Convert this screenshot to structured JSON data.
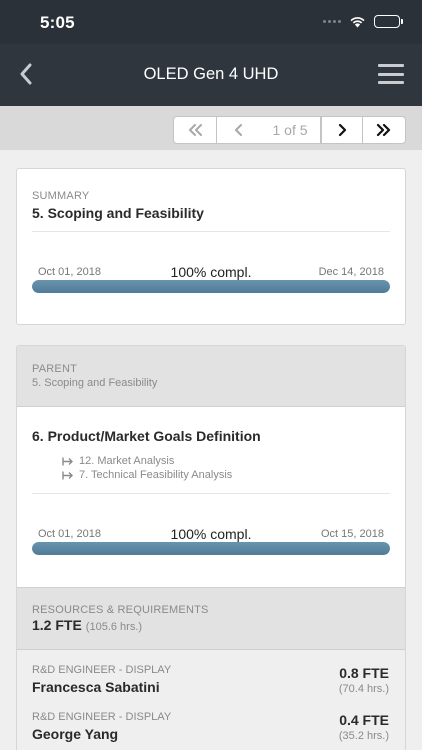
{
  "status_bar": {
    "time": "5:05"
  },
  "nav": {
    "title": "OLED Gen 4 UHD"
  },
  "pager": {
    "label": "1 of 5"
  },
  "summary": {
    "label": "SUMMARY",
    "title": "5. Scoping and Feasibility",
    "start_date": "Oct 01, 2018",
    "end_date": "Dec 14, 2018",
    "completion_text": "100% compl.",
    "progress": 1.0
  },
  "task": {
    "parent_label": "PARENT",
    "parent_name": "5. Scoping and Feasibility",
    "title": "6. Product/Market Goals Definition",
    "dependencies": [
      {
        "label": "12. Market Analysis"
      },
      {
        "label": "7. Technical Feasibility Analysis"
      }
    ],
    "start_date": "Oct 01, 2018",
    "end_date": "Oct 15, 2018",
    "completion_text": "100% compl.",
    "progress": 1.0
  },
  "resources": {
    "label": "RESOURCES & REQUIREMENTS",
    "total_fte": "1.2 FTE",
    "total_hours": "(105.6 hrs.)",
    "people": [
      {
        "role": "R&D ENGINEER - DISPLAY",
        "name": "Francesca Sabatini",
        "fte": "0.8 FTE",
        "hours": "(70.4 hrs.)"
      },
      {
        "role": "R&D ENGINEER - DISPLAY",
        "name": "George Yang",
        "fte": "0.4 FTE",
        "hours": "(35.2 hrs.)"
      }
    ]
  },
  "colors": {
    "nav_background": "#2f363e",
    "progress_fill": "#5b88a3",
    "section_gray": "#e2e2e2"
  },
  "icons": [
    "back-chevron-icon",
    "hamburger-menu-icon",
    "first-page-icon",
    "previous-page-icon",
    "next-page-icon",
    "last-page-icon",
    "wifi-icon",
    "battery-icon",
    "dependency-arrow-icon"
  ]
}
